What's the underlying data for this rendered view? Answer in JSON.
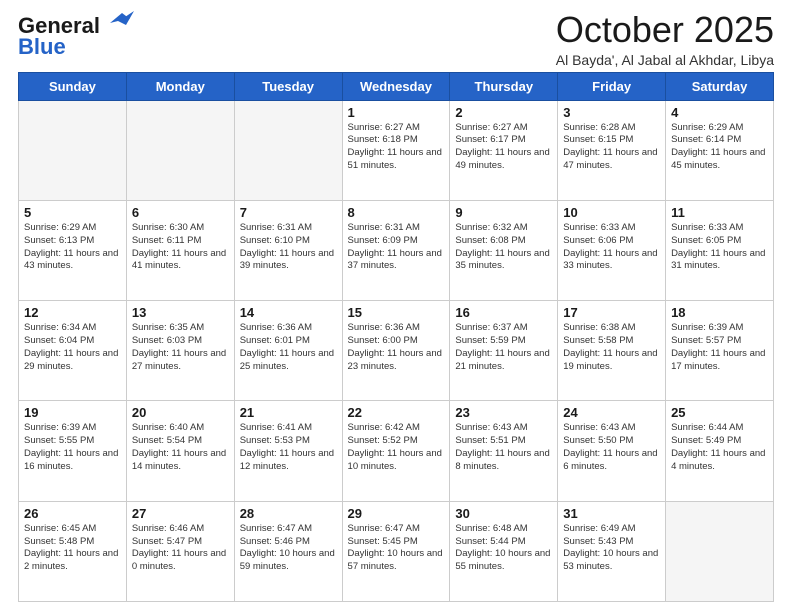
{
  "logo": {
    "line1": "General",
    "line2": "Blue"
  },
  "title": "October 2025",
  "subtitle": "Al Bayda', Al Jabal al Akhdar, Libya",
  "weekdays": [
    "Sunday",
    "Monday",
    "Tuesday",
    "Wednesday",
    "Thursday",
    "Friday",
    "Saturday"
  ],
  "weeks": [
    [
      {
        "day": "",
        "info": ""
      },
      {
        "day": "",
        "info": ""
      },
      {
        "day": "",
        "info": ""
      },
      {
        "day": "1",
        "info": "Sunrise: 6:27 AM\nSunset: 6:18 PM\nDaylight: 11 hours\nand 51 minutes."
      },
      {
        "day": "2",
        "info": "Sunrise: 6:27 AM\nSunset: 6:17 PM\nDaylight: 11 hours\nand 49 minutes."
      },
      {
        "day": "3",
        "info": "Sunrise: 6:28 AM\nSunset: 6:15 PM\nDaylight: 11 hours\nand 47 minutes."
      },
      {
        "day": "4",
        "info": "Sunrise: 6:29 AM\nSunset: 6:14 PM\nDaylight: 11 hours\nand 45 minutes."
      }
    ],
    [
      {
        "day": "5",
        "info": "Sunrise: 6:29 AM\nSunset: 6:13 PM\nDaylight: 11 hours\nand 43 minutes."
      },
      {
        "day": "6",
        "info": "Sunrise: 6:30 AM\nSunset: 6:11 PM\nDaylight: 11 hours\nand 41 minutes."
      },
      {
        "day": "7",
        "info": "Sunrise: 6:31 AM\nSunset: 6:10 PM\nDaylight: 11 hours\nand 39 minutes."
      },
      {
        "day": "8",
        "info": "Sunrise: 6:31 AM\nSunset: 6:09 PM\nDaylight: 11 hours\nand 37 minutes."
      },
      {
        "day": "9",
        "info": "Sunrise: 6:32 AM\nSunset: 6:08 PM\nDaylight: 11 hours\nand 35 minutes."
      },
      {
        "day": "10",
        "info": "Sunrise: 6:33 AM\nSunset: 6:06 PM\nDaylight: 11 hours\nand 33 minutes."
      },
      {
        "day": "11",
        "info": "Sunrise: 6:33 AM\nSunset: 6:05 PM\nDaylight: 11 hours\nand 31 minutes."
      }
    ],
    [
      {
        "day": "12",
        "info": "Sunrise: 6:34 AM\nSunset: 6:04 PM\nDaylight: 11 hours\nand 29 minutes."
      },
      {
        "day": "13",
        "info": "Sunrise: 6:35 AM\nSunset: 6:03 PM\nDaylight: 11 hours\nand 27 minutes."
      },
      {
        "day": "14",
        "info": "Sunrise: 6:36 AM\nSunset: 6:01 PM\nDaylight: 11 hours\nand 25 minutes."
      },
      {
        "day": "15",
        "info": "Sunrise: 6:36 AM\nSunset: 6:00 PM\nDaylight: 11 hours\nand 23 minutes."
      },
      {
        "day": "16",
        "info": "Sunrise: 6:37 AM\nSunset: 5:59 PM\nDaylight: 11 hours\nand 21 minutes."
      },
      {
        "day": "17",
        "info": "Sunrise: 6:38 AM\nSunset: 5:58 PM\nDaylight: 11 hours\nand 19 minutes."
      },
      {
        "day": "18",
        "info": "Sunrise: 6:39 AM\nSunset: 5:57 PM\nDaylight: 11 hours\nand 17 minutes."
      }
    ],
    [
      {
        "day": "19",
        "info": "Sunrise: 6:39 AM\nSunset: 5:55 PM\nDaylight: 11 hours\nand 16 minutes."
      },
      {
        "day": "20",
        "info": "Sunrise: 6:40 AM\nSunset: 5:54 PM\nDaylight: 11 hours\nand 14 minutes."
      },
      {
        "day": "21",
        "info": "Sunrise: 6:41 AM\nSunset: 5:53 PM\nDaylight: 11 hours\nand 12 minutes."
      },
      {
        "day": "22",
        "info": "Sunrise: 6:42 AM\nSunset: 5:52 PM\nDaylight: 11 hours\nand 10 minutes."
      },
      {
        "day": "23",
        "info": "Sunrise: 6:43 AM\nSunset: 5:51 PM\nDaylight: 11 hours\nand 8 minutes."
      },
      {
        "day": "24",
        "info": "Sunrise: 6:43 AM\nSunset: 5:50 PM\nDaylight: 11 hours\nand 6 minutes."
      },
      {
        "day": "25",
        "info": "Sunrise: 6:44 AM\nSunset: 5:49 PM\nDaylight: 11 hours\nand 4 minutes."
      }
    ],
    [
      {
        "day": "26",
        "info": "Sunrise: 6:45 AM\nSunset: 5:48 PM\nDaylight: 11 hours\nand 2 minutes."
      },
      {
        "day": "27",
        "info": "Sunrise: 6:46 AM\nSunset: 5:47 PM\nDaylight: 11 hours\nand 0 minutes."
      },
      {
        "day": "28",
        "info": "Sunrise: 6:47 AM\nSunset: 5:46 PM\nDaylight: 10 hours\nand 59 minutes."
      },
      {
        "day": "29",
        "info": "Sunrise: 6:47 AM\nSunset: 5:45 PM\nDaylight: 10 hours\nand 57 minutes."
      },
      {
        "day": "30",
        "info": "Sunrise: 6:48 AM\nSunset: 5:44 PM\nDaylight: 10 hours\nand 55 minutes."
      },
      {
        "day": "31",
        "info": "Sunrise: 6:49 AM\nSunset: 5:43 PM\nDaylight: 10 hours\nand 53 minutes."
      },
      {
        "day": "",
        "info": ""
      }
    ]
  ]
}
